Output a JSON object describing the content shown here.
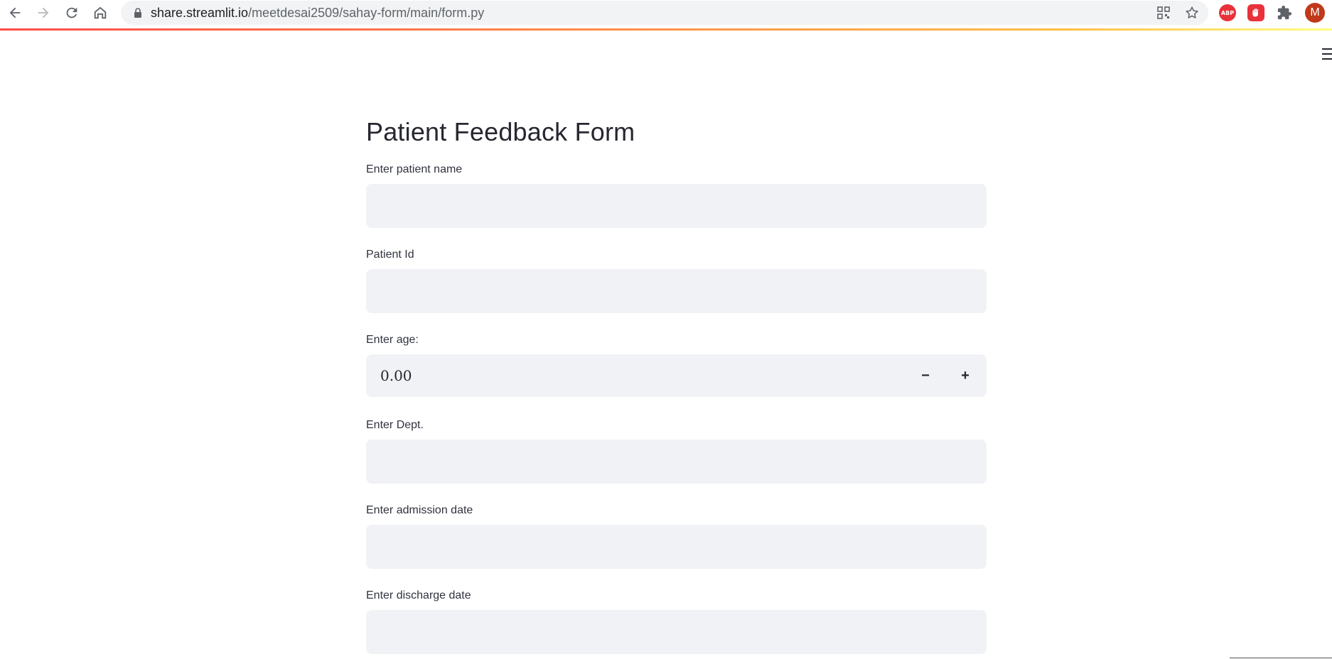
{
  "browser": {
    "url_host": "share.streamlit.io",
    "url_path": "/meetdesai2509/sahay-form/main/form.py",
    "avatar_initial": "M",
    "abp_label": "ABP"
  },
  "page": {
    "title": "Patient Feedback Form"
  },
  "form": {
    "patient_name": {
      "label": "Enter patient name",
      "value": ""
    },
    "patient_id": {
      "label": "Patient Id",
      "value": ""
    },
    "age": {
      "label": "Enter age:",
      "value": "0.00",
      "decrement": "−",
      "increment": "+"
    },
    "dept": {
      "label": "Enter Dept.",
      "value": ""
    },
    "admission_date": {
      "label": "Enter admission date",
      "value": ""
    },
    "discharge_date": {
      "label": "Enter discharge date",
      "value": ""
    }
  },
  "colors": {
    "input_bg": "#f0f2f6",
    "text": "#262730",
    "accent_gradient_start": "#ff4b4b",
    "accent_gradient_end": "#fffd80"
  }
}
